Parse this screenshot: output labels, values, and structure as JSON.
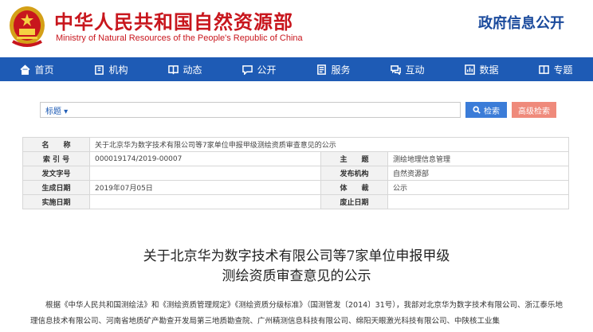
{
  "header": {
    "site_title_cn": "中华人民共和国自然资源部",
    "site_title_en": "Ministry of Natural Resources of the People's Republic of China",
    "section_title": "政府信息公开"
  },
  "nav": {
    "items": [
      {
        "label": "首页",
        "icon": "home-icon"
      },
      {
        "label": "机构",
        "icon": "building-icon"
      },
      {
        "label": "动态",
        "icon": "book-icon"
      },
      {
        "label": "公开",
        "icon": "chat-icon"
      },
      {
        "label": "服务",
        "icon": "document-icon"
      },
      {
        "label": "互动",
        "icon": "chat-icon"
      },
      {
        "label": "数据",
        "icon": "chart-icon"
      },
      {
        "label": "专题",
        "icon": "topic-icon"
      }
    ]
  },
  "search": {
    "category": "标题",
    "placeholder": "",
    "search_label": "检索",
    "advanced_label": "高级检索"
  },
  "meta": {
    "name_label": "名　　称",
    "name_value": "关于北京华为数字技术有限公司等7家单位申报甲级测绘资质审查意见的公示",
    "index_label": "索 引 号",
    "index_value": "000019174/2019-00007",
    "topic_label": "主　　题",
    "topic_value": "测绘地理信息管理",
    "docno_label": "发文字号",
    "docno_value": "",
    "issuer_label": "发布机构",
    "issuer_value": "自然资源部",
    "date_label": "生成日期",
    "date_value": "2019年07月05日",
    "genre_label": "体　　裁",
    "genre_value": "公示",
    "impl_label": "实施日期",
    "impl_value": "",
    "expire_label": "废止日期",
    "expire_value": ""
  },
  "document": {
    "title_line1": "关于北京华为数字技术有限公司等7家单位申报甲级",
    "title_line2": "测绘资质审查意见的公示",
    "body": "根据《中华人民共和国测绘法》和《测绘资质管理规定》《测绘资质分级标准》（国测管发〔2014〕31号），我部对北京华为数字技术有限公司、浙江泰乐地理信息技术有限公司、河南省地质矿产勘查开发局第三地质勘查院、广州精测信息科技有限公司、绵阳天眼激光科技有限公司、中陕核工业集"
  },
  "colors": {
    "brand_red": "#c8161d",
    "nav_blue": "#1e5bb5",
    "search_blue": "#3b7cd8",
    "advanced_pink": "#ef8a7b"
  }
}
